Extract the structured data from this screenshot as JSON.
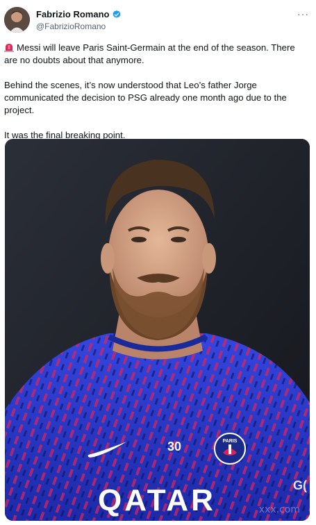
{
  "author": {
    "display_name": "Fabrizio Romano",
    "handle": "@FabrizioRomano",
    "verified_icon": "verified-badge-icon"
  },
  "menu": {
    "more_label": "···"
  },
  "tweet": {
    "emoji": "rotating-light-icon",
    "line1": "Messi will leave Paris Saint-Germain at the end of the season. There are no doubts about that anymore.",
    "line2": "Behind the scenes, it’s now understood that Leo’s father Jorge communicated the decision to PSG already one month ago due to the project.",
    "line3": "It was the final breaking point."
  },
  "media": {
    "jersey_number": "30",
    "crest_text": "PARIS",
    "sponsor": "QATAR",
    "sleeve_text": "G(",
    "watermark": "xxx.com"
  },
  "colors": {
    "verified": "#1d9bf0",
    "jersey": "#2a3bd6",
    "background": "#1a1d24"
  }
}
